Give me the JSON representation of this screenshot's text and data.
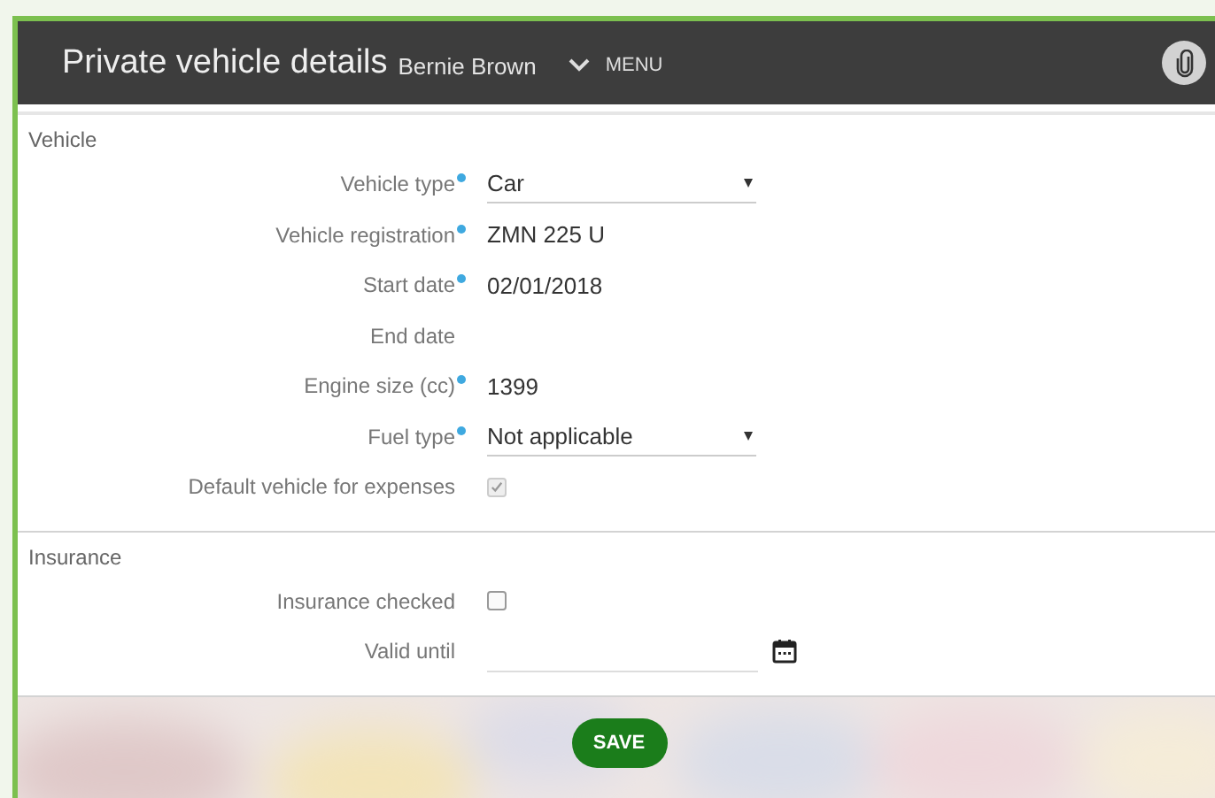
{
  "header": {
    "title": "Private vehicle details",
    "subtitle": "Bernie Brown",
    "menu": "MENU"
  },
  "sections": [
    {
      "title": "Vehicle",
      "fields": [
        {
          "kind": "select",
          "label": "Vehicle type",
          "required": true,
          "value": "Car"
        },
        {
          "kind": "text",
          "label": "Vehicle registration",
          "required": true,
          "value": "ZMN 225 U"
        },
        {
          "kind": "text",
          "label": "Start date",
          "required": true,
          "value": "02/01/2018"
        },
        {
          "kind": "text",
          "label": "End date",
          "required": false
        },
        {
          "kind": "text",
          "label": "Engine size (cc)",
          "required": true,
          "value": "1399"
        },
        {
          "kind": "select",
          "label": "Fuel type",
          "required": true,
          "value": "Not applicable"
        },
        {
          "kind": "checkbox",
          "label": "Default vehicle for expenses",
          "required": false,
          "checked": true,
          "disabled": true
        }
      ]
    },
    {
      "title": "Insurance",
      "fields": [
        {
          "kind": "checkbox",
          "label": "Insurance checked",
          "required": false,
          "checked": false,
          "disabled": false
        },
        {
          "kind": "date",
          "label": "Valid until",
          "required": false
        }
      ]
    }
  ],
  "save": "SAVE"
}
